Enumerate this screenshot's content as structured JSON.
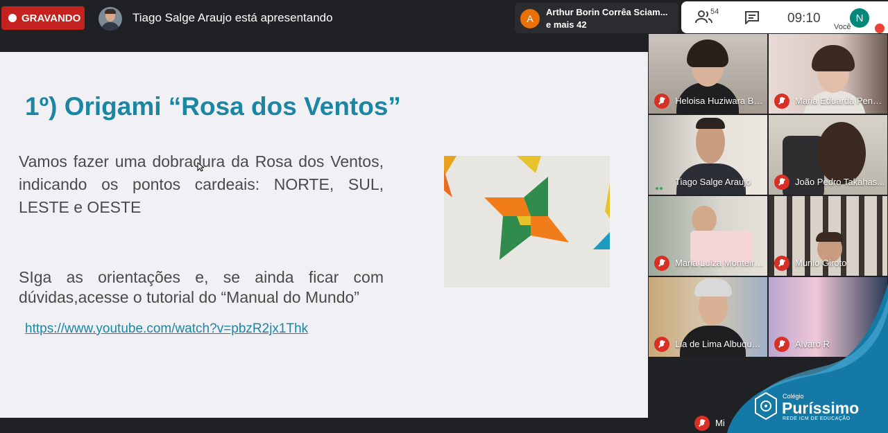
{
  "topbar": {
    "recording_label": "GRAVANDO",
    "presenter_text": "Tiago Salge Araujo está apresentando",
    "participants_chip": {
      "avatar_letter": "A",
      "name": "Arthur Borin Corrêa Sciam...",
      "more": "e mais 42"
    },
    "people_count": "54",
    "time": "09:10",
    "self_avatar_letter": "N",
    "self_label": "Você",
    "icons": [
      "record-dot-icon",
      "people-icon",
      "chat-icon",
      "mic-off-icon"
    ]
  },
  "slide": {
    "title": "1º) Origami “Rosa dos Ventos”",
    "paragraph1": "Vamos fazer uma dobradura da Rosa dos Ventos, indicando os pontos cardeais: NORTE, SUL, LESTE e OESTE",
    "paragraph2": "SIga as orientações e, se ainda ficar com dúvidas,acesse o tutorial do “Manual do Mundo”",
    "link": "https://www.youtube.com/watch?v=pbzR2jx1Thk"
  },
  "participants": [
    {
      "name": "Heloisa Huziwara Ba...",
      "muted": true
    },
    {
      "name": "Maria Eduarda Penh...",
      "muted": true
    },
    {
      "name": "Tiago Salge Araujo",
      "muted": false,
      "speaking": true
    },
    {
      "name": "João Pedro Takahas...",
      "muted": true
    },
    {
      "name": "Maria Luiza Monteiro...",
      "muted": true
    },
    {
      "name": "Murilo Giroto",
      "muted": true
    },
    {
      "name": "Lia de Lima Albuquer...",
      "muted": true
    },
    {
      "name": "Alvaro R",
      "muted": true
    },
    {
      "name": "Mi",
      "muted": true
    }
  ],
  "branding": {
    "small": "Colégio",
    "name": "Puríssimo",
    "sub": "REDE ICM DE EDUCAÇÃO"
  },
  "colors": {
    "recording": "#c5221f",
    "slide_accent": "#1b86a4",
    "brand_blue": "#1579a6"
  }
}
